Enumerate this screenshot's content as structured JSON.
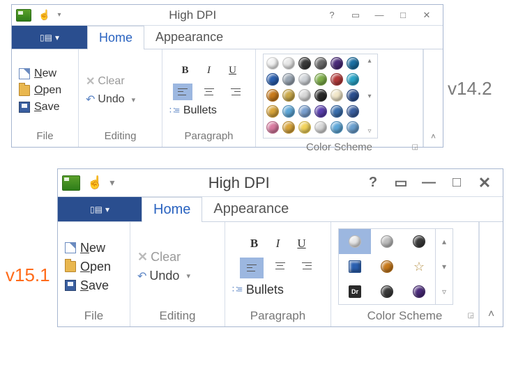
{
  "versions": {
    "v142": "v14.2",
    "v151": "v15.1"
  },
  "titlebar": {
    "title": "High DPI",
    "help": "?"
  },
  "tabs": {
    "file_glyph": "▯▤ ▾",
    "home": "Home",
    "appearance": "Appearance"
  },
  "groups": {
    "file": {
      "label": "File",
      "new": "New",
      "new_k": "N",
      "open": "Open",
      "open_k": "O",
      "save": "Save",
      "save_k": "S"
    },
    "editing": {
      "label": "Editing",
      "clear": "Clear",
      "clear_k": "C",
      "undo": "Undo",
      "undo_k": "U"
    },
    "paragraph": {
      "label": "Paragraph",
      "b": "B",
      "i": "I",
      "u": "U",
      "bullets": "Bullets",
      "bullets_k": "B"
    },
    "colorscheme": {
      "label": "Color Scheme",
      "orbs_v142": [
        "#f2f2f2",
        "#e8e8e8",
        "#3a3a3a",
        "#6b6b6b",
        "#4a2a7a",
        "#1a6fa3",
        "#2a5fb0",
        "#9aa6b3",
        "#d0d4d9",
        "#7fb04a",
        "#b43a3a",
        "#2aa6c9",
        "#c97a1a",
        "#caa94a",
        "#d9d9d9",
        "#2a2a2a",
        "#f2e7c9",
        "#2a4e8f",
        "#d9a53a",
        "#5ea8d9",
        "#7aa0d0",
        "#5a3fae",
        "#3a6fae",
        "#3a5fa0",
        "#d97aa0",
        "#d9a53a",
        "#f2d35a",
        "#d9d9d9",
        "#5ea8d9",
        "#6aa0d0"
      ],
      "items_v151": [
        {
          "c": "#e8e8e8",
          "sel": true
        },
        {
          "c": "#bfbfbf"
        },
        {
          "c": "#3a3a3a"
        },
        {
          "c": "#2a5fb0",
          "sq": true
        },
        {
          "c": "#c97a1a"
        },
        {
          "c": "#caa94a",
          "star": true
        },
        {
          "c": "#2a2a2a",
          "sq": true,
          "txt": "Dr"
        },
        {
          "c": "#3a3a3a"
        },
        {
          "c": "#4a2a7a"
        }
      ]
    }
  }
}
